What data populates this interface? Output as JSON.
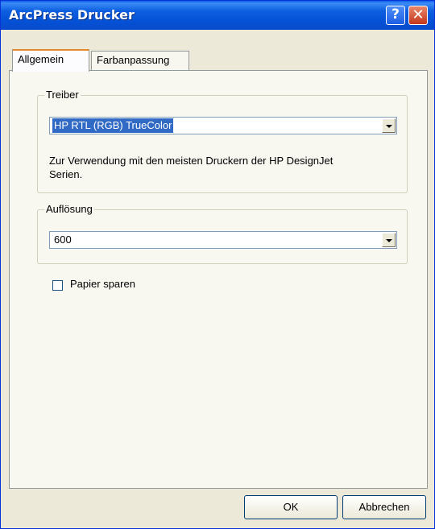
{
  "window": {
    "title": "ArcPress Drucker"
  },
  "titlebar": {
    "help_glyph": "?",
    "close_glyph": "✕"
  },
  "tabs": [
    {
      "label": "Allgemein",
      "selected": true
    },
    {
      "label": "Farbanpassung",
      "selected": false
    }
  ],
  "driver": {
    "group_label": "Treiber",
    "selected": "HP RTL (RGB) TrueColor",
    "description": "Zur Verwendung mit den meisten Druckern der HP DesignJet Serien."
  },
  "resolution": {
    "group_label": "Auflösung",
    "selected": "600"
  },
  "save_paper": {
    "label": "Papier sparen",
    "checked": false
  },
  "buttons": {
    "ok": "OK",
    "cancel": "Abbrechen"
  }
}
